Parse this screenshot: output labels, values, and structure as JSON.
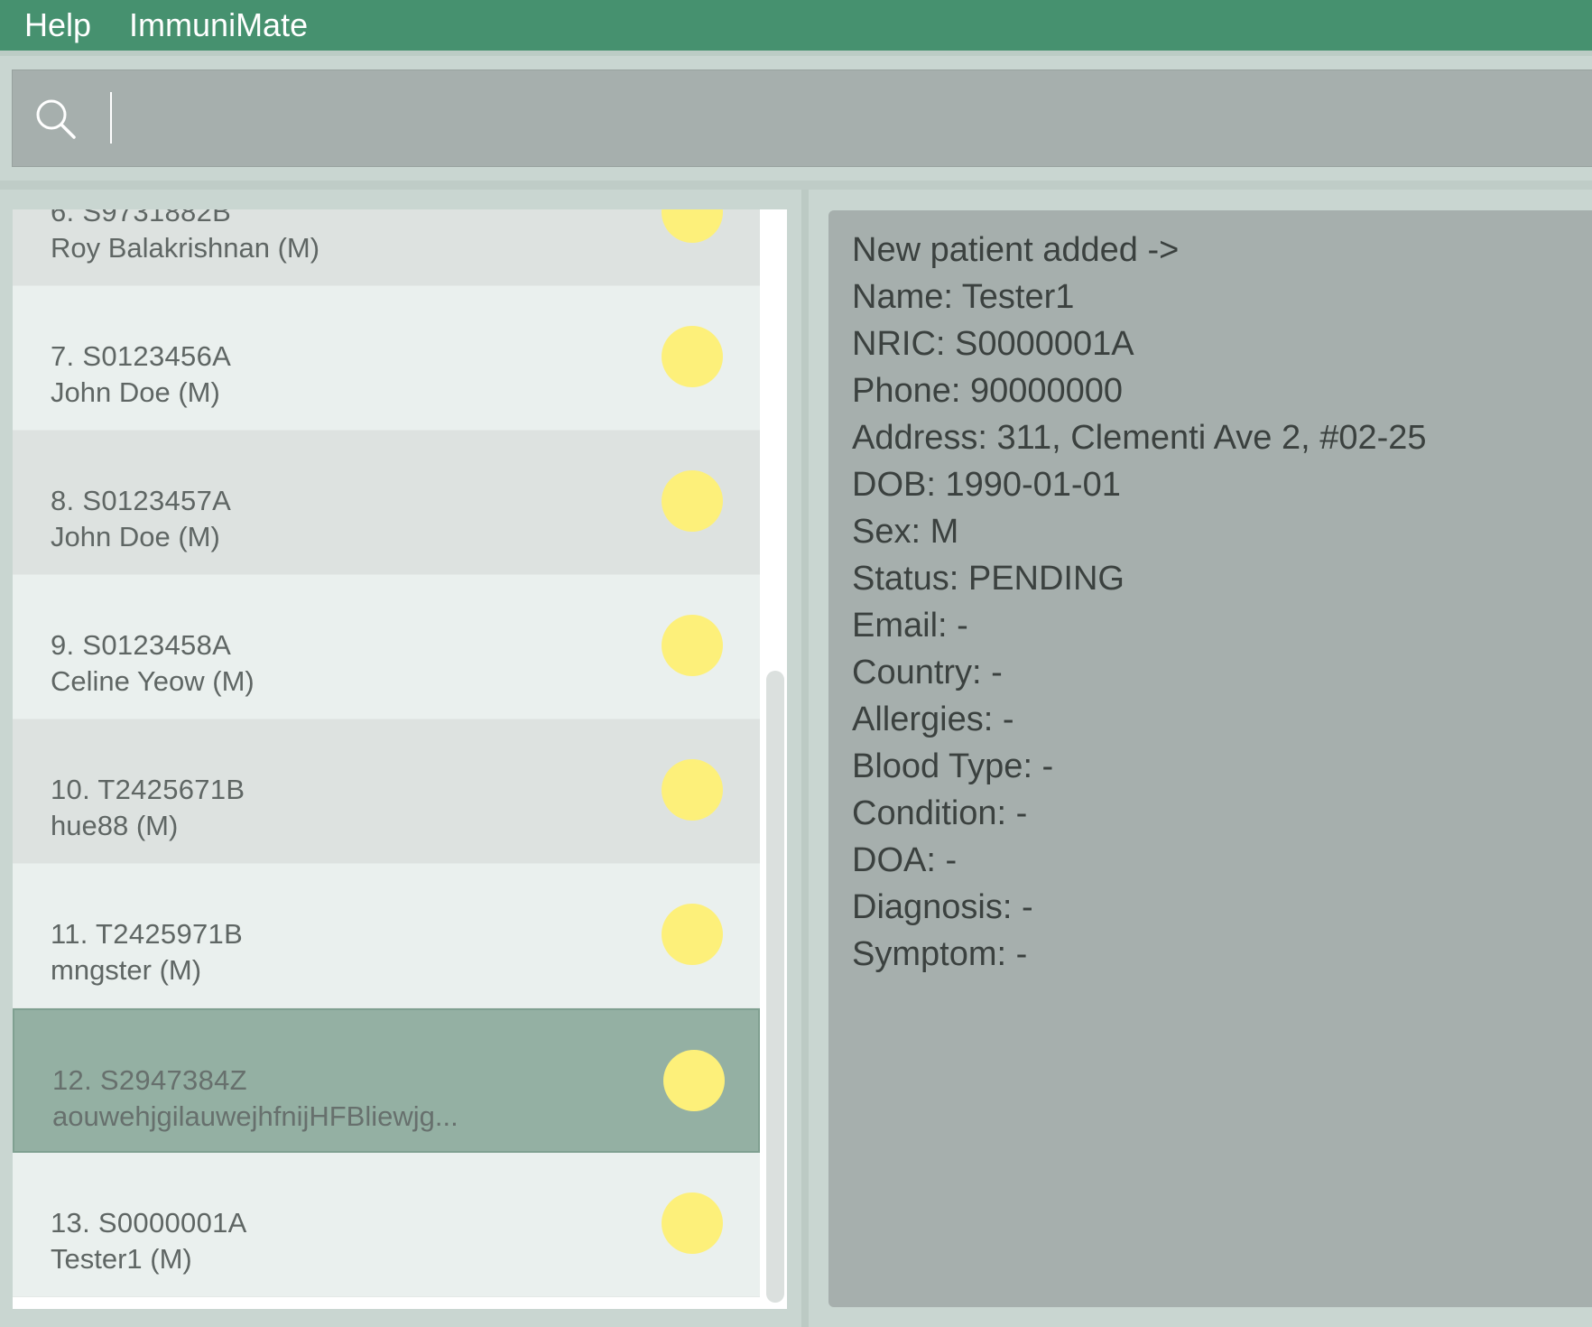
{
  "menubar": {
    "items": [
      "Help",
      "ImmuniMate"
    ],
    "background": "#46916f"
  },
  "command_box": {
    "value": "",
    "icon": "search-icon"
  },
  "patients": [
    {
      "id": "6. S9731882B",
      "name": "Roy Balakrishnan (M)",
      "status_color": "#fdf07a"
    },
    {
      "id": "7. S0123456A",
      "name": "John Doe (M)",
      "status_color": "#fdf07a"
    },
    {
      "id": "8. S0123457A",
      "name": "John Doe (M)",
      "status_color": "#fdf07a"
    },
    {
      "id": "9. S0123458A",
      "name": "Celine Yeow (M)",
      "status_color": "#fdf07a"
    },
    {
      "id": "10. T2425671B",
      "name": "hue88 (M)",
      "status_color": "#fdf07a"
    },
    {
      "id": "11. T2425971B",
      "name": "mngster (M)",
      "status_color": "#fdf07a"
    },
    {
      "id": "12. S2947384Z",
      "name": "aouwehjgilauwejhfnijHFBliewjg...",
      "status_color": "#fdf07a",
      "selected": true
    },
    {
      "id": "13. S0000001A",
      "name": "Tester1 (M)",
      "status_color": "#fdf07a"
    }
  ],
  "result": {
    "lines": [
      "New patient added ->",
      "Name: Tester1",
      "NRIC: S0000001A",
      "Phone: 90000000",
      "Address: 311, Clementi Ave 2, #02-25",
      "DOB: 1990-01-01",
      "Sex: M",
      "Status: PENDING",
      "Email: -",
      "Country: -",
      "Allergies: -",
      "Blood Type: -",
      "Condition: -",
      "DOA: -",
      "Diagnosis: -",
      "Symptom: -"
    ]
  }
}
